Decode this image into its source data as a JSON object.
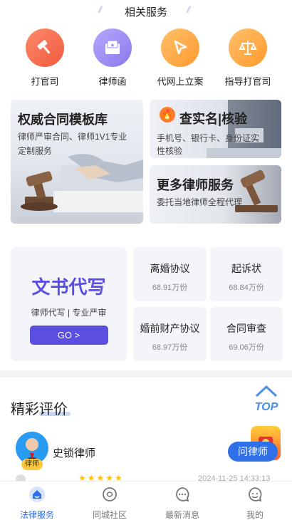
{
  "header": {
    "section_title": "相关服务"
  },
  "services": [
    {
      "label": "打官司",
      "icon": "gavel-icon",
      "color": "#f26a4b"
    },
    {
      "label": "律师函",
      "icon": "mail-star-icon",
      "color": "#9a8cf0"
    },
    {
      "label": "代网上立案",
      "icon": "cursor-icon",
      "color": "#ffa53c"
    },
    {
      "label": "指导打官司",
      "icon": "scales-icon",
      "color": "#ffa53c"
    }
  ],
  "banners": {
    "contract": {
      "title": "权威合同模板库",
      "subtitle_lines": [
        "律师严审合同、律师1V1专业",
        "定制服务"
      ]
    },
    "verify": {
      "title": "查实名|核验",
      "subtitle_lines": [
        "手机号、银行卡、身份证实",
        "性核验"
      ]
    },
    "lawyer_service": {
      "title": "更多律师服务",
      "subtitle": "委托当地律师全程代理"
    }
  },
  "writing": {
    "title": "文书代写",
    "subtitle": "律师代写 | 专业严审",
    "button": "GO >",
    "accent": "#5a4fe0"
  },
  "documents": [
    {
      "name": "离婚协议",
      "count": "68.91万份"
    },
    {
      "name": "起诉状",
      "count": "68.84万份"
    },
    {
      "name": "婚前财产协议",
      "count": "68.97万份"
    },
    {
      "name": "合同审查",
      "count": "69.06万份"
    }
  ],
  "reviews": {
    "title": "精彩评价",
    "lawyer_name": "史锁律师",
    "badge": "律师",
    "ask_button": "问律师",
    "date": "2024-11-25 14:33:13"
  },
  "top_button": "TOP",
  "tabbar": [
    {
      "label": "法律服务",
      "icon": "home-icon",
      "active": true
    },
    {
      "label": "同城社区",
      "icon": "community-icon",
      "active": false
    },
    {
      "label": "最新消息",
      "icon": "message-icon",
      "active": false
    },
    {
      "label": "我的",
      "icon": "profile-icon",
      "active": false
    }
  ],
  "colors": {
    "active_tab": "#2f6fe8",
    "inactive_tab": "#777777"
  }
}
